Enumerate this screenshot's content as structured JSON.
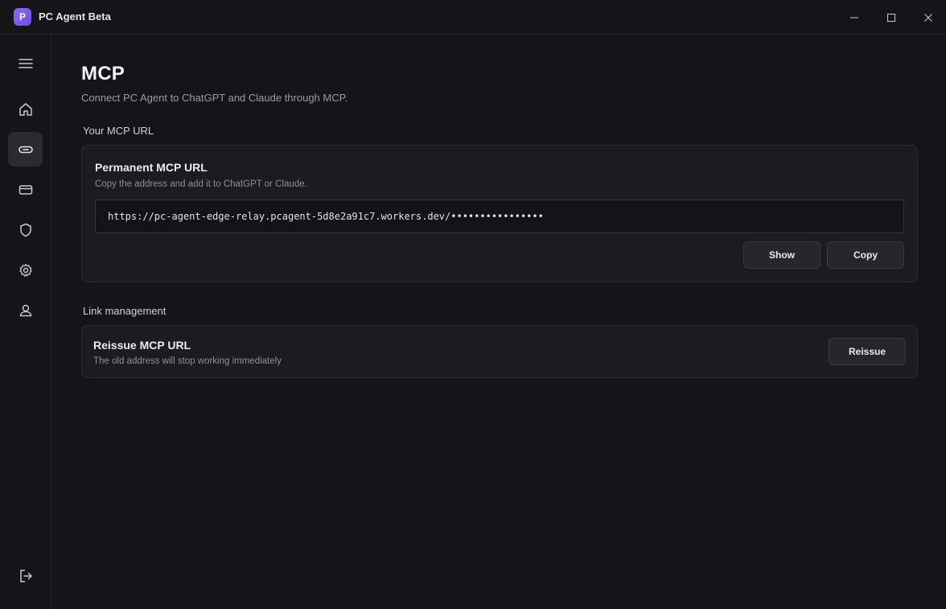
{
  "window": {
    "logo_letter": "P",
    "title": "PC Agent Beta"
  },
  "sidebar": {
    "items": [
      {
        "icon": "menu-icon"
      },
      {
        "icon": "home-icon"
      },
      {
        "icon": "link-icon",
        "active": true
      },
      {
        "icon": "card-icon"
      },
      {
        "icon": "shield-icon"
      },
      {
        "icon": "gear-icon"
      },
      {
        "icon": "user-icon"
      },
      {
        "icon": "logout-icon"
      }
    ]
  },
  "page": {
    "title": "MCP",
    "subtitle": "Connect PC Agent to ChatGPT and Claude through MCP."
  },
  "mcp_url_section": {
    "label": "Your MCP URL",
    "card": {
      "title": "Permanent MCP URL",
      "description": "Copy the address and add it to ChatGPT or Claude.",
      "url_value": "https://pc-agent-edge-relay.pcagent-5d8e2a91c7.workers.dev/••••••••••••••••",
      "show_label": "Show",
      "copy_label": "Copy"
    }
  },
  "link_management_section": {
    "label": "Link management",
    "card": {
      "title": "Reissue MCP URL",
      "description": "The old address will stop working immediately",
      "reissue_label": "Reissue"
    }
  },
  "colors": {
    "background": "#151519",
    "card": "#1b1b20",
    "accent": "#7b5cf0"
  }
}
